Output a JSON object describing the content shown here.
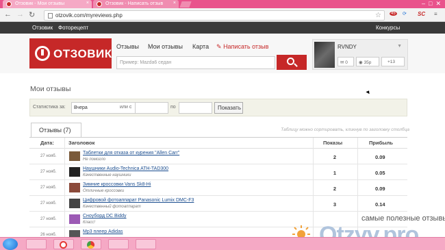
{
  "browser": {
    "tabs": [
      {
        "label": "Отзовик - Мои отзывы"
      },
      {
        "label": "Отзовик - Написать отзыв"
      }
    ],
    "url": "otzovik.com/myreviews.php",
    "ext_badge": "45",
    "ext_sc": "SC"
  },
  "sitebar": {
    "left_links": [
      "Отзовик",
      "Фоторецепт"
    ],
    "right_link": "Конкурсы"
  },
  "header": {
    "logo_text": "ОТЗОВИК",
    "nav": [
      "Отзывы",
      "Мои отзывы",
      "Карта"
    ],
    "write_label": "Написать отзыв",
    "search_placeholder": "Пример: Mazda6 седан",
    "user": {
      "name": "RVNDY",
      "messages": "0",
      "points": "35р",
      "rating": "+13"
    }
  },
  "page": {
    "title": "Мои отзывы",
    "stats": {
      "label": "Статистика за:",
      "period": "Вчера",
      "from_label": "или с",
      "to_label": "по",
      "button": "Показать"
    },
    "tab_label": "Отзывы (7)",
    "hint": "Таблицу можно сортировать, кликнув по заголовку столбца"
  },
  "table": {
    "columns": [
      "Дата:",
      "Заголовок",
      "Показы",
      "Прибыль"
    ],
    "rows": [
      {
        "date": "27 нояб.",
        "title": "Таблетки для отказа от курения \"Allen Carr\"",
        "subtitle": "Не помогло",
        "views": "2",
        "profit": "0.09",
        "thumb": "#7a5a3a"
      },
      {
        "date": "27 нояб.",
        "title": "Наушники Audio-Technica ATH-TAD300",
        "subtitle": "Качественные наушники",
        "views": "1",
        "profit": "0.05",
        "thumb": "#222222"
      },
      {
        "date": "27 нояб.",
        "title": "Зимние кроссовки Vans Sk8-Hi",
        "subtitle": "Отличные кроссовки",
        "views": "2",
        "profit": "0.09",
        "thumb": "#8b4a3a"
      },
      {
        "date": "27 нояб.",
        "title": "Цифровой фотоаппарат Panasonic Lumix DMC-F3",
        "subtitle": "Качественный фотоаппарат",
        "views": "3",
        "profit": "0.14",
        "thumb": "#444444"
      },
      {
        "date": "27 нояб.",
        "title": "Сноуборд DC Biddy",
        "subtitle": "Класс!",
        "views": "",
        "profit": "",
        "thumb": "#9c5ab5"
      },
      {
        "date": "26 нояб.",
        "title": "Mp3 плеер Adidas",
        "subtitle": "",
        "views": "",
        "profit": "",
        "thumb": "#555555"
      }
    ]
  },
  "watermark": {
    "tagline": "самые полезные отзывы",
    "brand": "Otzyv.pro"
  }
}
